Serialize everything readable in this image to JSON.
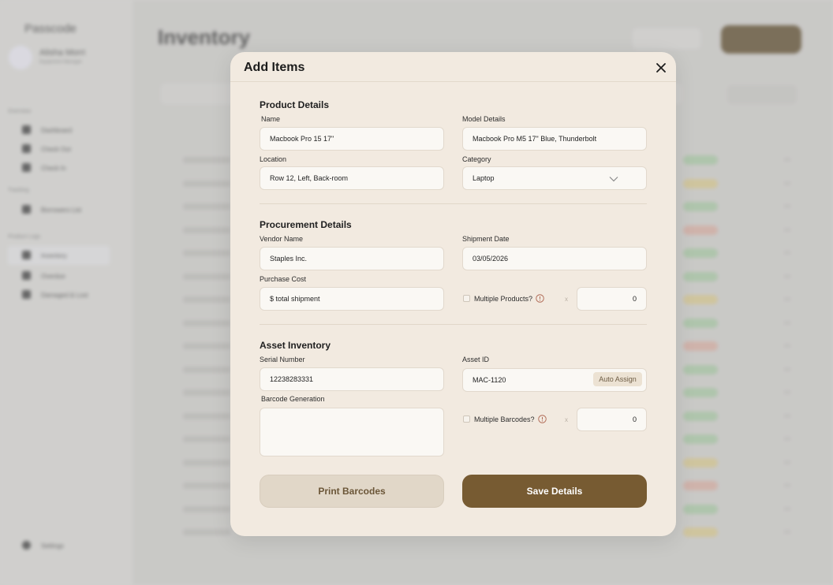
{
  "background": {
    "brand": "Passcode",
    "user": {
      "name": "Alisha Morri",
      "role": "Equipment Manager"
    },
    "nav_sections": [
      {
        "label": "Overview",
        "items": [
          "Dashboard",
          "Check Out",
          "Check In"
        ]
      },
      {
        "label": "Tracking",
        "items": [
          "Borrowers List"
        ]
      },
      {
        "label": "Product Logs",
        "items": [
          "Inventory",
          "Overdue",
          "Damaged & Lost"
        ]
      }
    ],
    "settings_label": "Settings",
    "page_title": "Inventory"
  },
  "modal": {
    "title": "Add Items",
    "product": {
      "heading": "Product Details",
      "name_label": "Name",
      "name_value": "Macbook Pro 15 17\"",
      "model_label": "Model Details",
      "model_value": "Macbook Pro M5 17\" Blue, Thunderbolt",
      "location_label": "Location",
      "location_value": "Row 12, Left, Back-room",
      "category_label": "Category",
      "category_value": "Laptop"
    },
    "procurement": {
      "heading": "Procurement Details",
      "vendor_label": "Vendor Name",
      "vendor_value": "Staples Inc.",
      "shipment_label": "Shipment Date",
      "shipment_value": "03/05/2026",
      "cost_label": "Purchase Cost",
      "cost_value": "$ total shipment",
      "multi_products_label": "Multiple Products?",
      "multi_products_qty": "0",
      "times": "x"
    },
    "asset": {
      "heading": "Asset Inventory",
      "serial_label": "Serial Number",
      "serial_value": "12238283331",
      "asset_id_label": "Asset ID",
      "asset_id_value": "MAC-1120",
      "auto_assign_label": "Auto Assign",
      "barcode_label": "Barcode Generation",
      "barcode_value": "",
      "multi_barcodes_label": "Multiple Barcodes?",
      "multi_barcodes_qty": "0",
      "times": "x"
    },
    "print_label": "Print Barcodes",
    "save_label": "Save Details"
  },
  "colors": {
    "accent": "#775b32",
    "modal_bg": "#f2eae0",
    "secondary_button": "#e1d7c8"
  }
}
